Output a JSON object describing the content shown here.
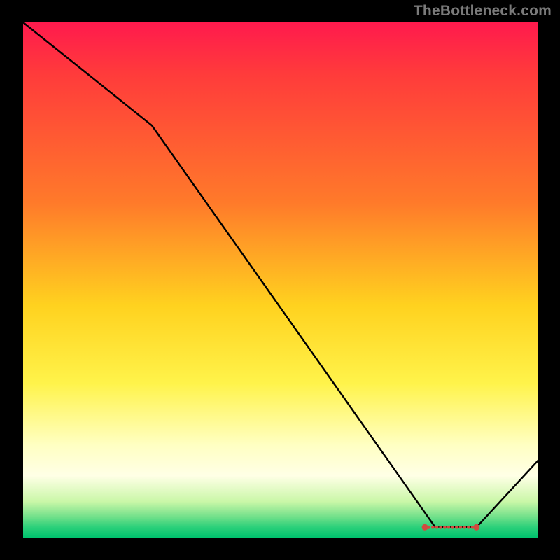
{
  "watermark": "TheBottleneck.com",
  "chart_data": {
    "type": "line",
    "title": "",
    "xlabel": "",
    "ylabel": "",
    "xlim": [
      0,
      100
    ],
    "ylim": [
      0,
      100
    ],
    "series": [
      {
        "name": "curve",
        "x": [
          0,
          25,
          80,
          88,
          100
        ],
        "values": [
          100,
          80,
          2,
          2,
          15
        ]
      }
    ],
    "markers": {
      "name": "baseline-dots",
      "color": "#d14b3f",
      "y": 2,
      "x_start": 78,
      "x_end": 88,
      "count": 14
    }
  },
  "colors": {
    "line": "#000000",
    "marker": "#d14b3f"
  }
}
